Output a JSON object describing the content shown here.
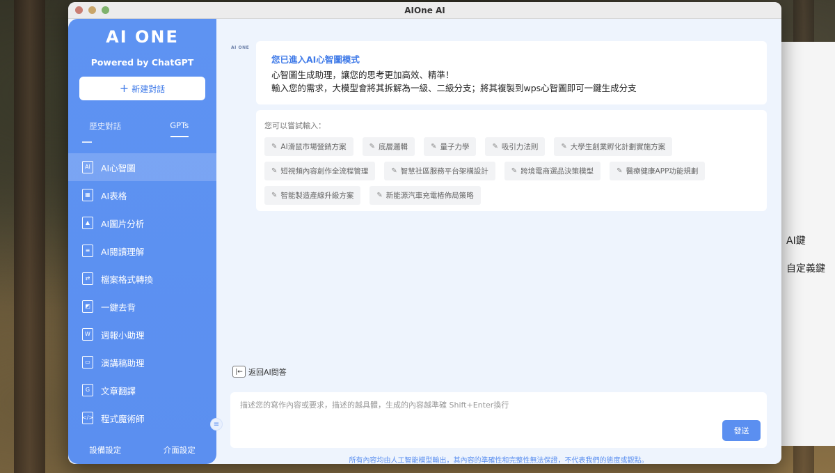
{
  "window": {
    "title": "AIOne AI"
  },
  "sidebar": {
    "logo": "AI ONE",
    "powered_by": "Powered by ChatGPT",
    "new_chat": {
      "plus": "+",
      "label": "新建對話"
    },
    "tabs": [
      {
        "label": "歷史對話",
        "active": false
      },
      {
        "label": "GPTs",
        "active": true
      }
    ],
    "items": [
      {
        "label": "AI心智圖",
        "icon": "mindmap-doc-icon",
        "active": true
      },
      {
        "label": "AI表格",
        "icon": "table-doc-icon"
      },
      {
        "label": "AI圖片分析",
        "icon": "image-doc-icon"
      },
      {
        "label": "AI閱讀理解",
        "icon": "book-icon"
      },
      {
        "label": "檔案格式轉換",
        "icon": "file-convert-icon"
      },
      {
        "label": "一鍵去背",
        "icon": "remove-background-icon"
      },
      {
        "label": "週報小助理",
        "icon": "word-doc-icon"
      },
      {
        "label": "演講稿助理",
        "icon": "presentation-icon"
      },
      {
        "label": "文章翻譯",
        "icon": "translate-icon"
      },
      {
        "label": "程式魔術師",
        "icon": "code-icon"
      }
    ],
    "bottom": {
      "settings": "設備設定",
      "interface": "介面設定"
    }
  },
  "main": {
    "small_logo": "AI ONE",
    "intro": {
      "title": "您已進入AI心智圖模式",
      "line1": "心智圖生成助理，讓您的思考更加高效、精準！",
      "line2": "輸入您的需求，大模型會將其拆解為一級、二級分支；將其複製到wps心智圖即可一鍵生成分支"
    },
    "suggest": {
      "label": "您可以嘗試輸入：",
      "chips": [
        "AI滑鼠市場營銷方案",
        "底層邏輯",
        "量子力學",
        "吸引力法則",
        "大學生創業孵化計劃實施方案",
        "短視頻內容創作全流程管理",
        "智慧社區服務平台架構設計",
        "跨境電商選品決策模型",
        "醫療健康APP功能規劃",
        "智能製造產線升級方案",
        "新能源汽車充電樁佈局策略"
      ]
    },
    "back_label": "返回AI問答",
    "input": {
      "placeholder": "描述您的寫作內容或要求，描述的越具體，生成的內容越準確 Shift+Enter換行",
      "value": ""
    },
    "send_label": "發送",
    "disclaimer": "所有內容均由人工智能模型輸出，其內容的準確性和完整性無法保證，不代表我們的態度或觀點。"
  },
  "background_window": {
    "line1": "AI鍵",
    "line2": "自定義鍵"
  }
}
